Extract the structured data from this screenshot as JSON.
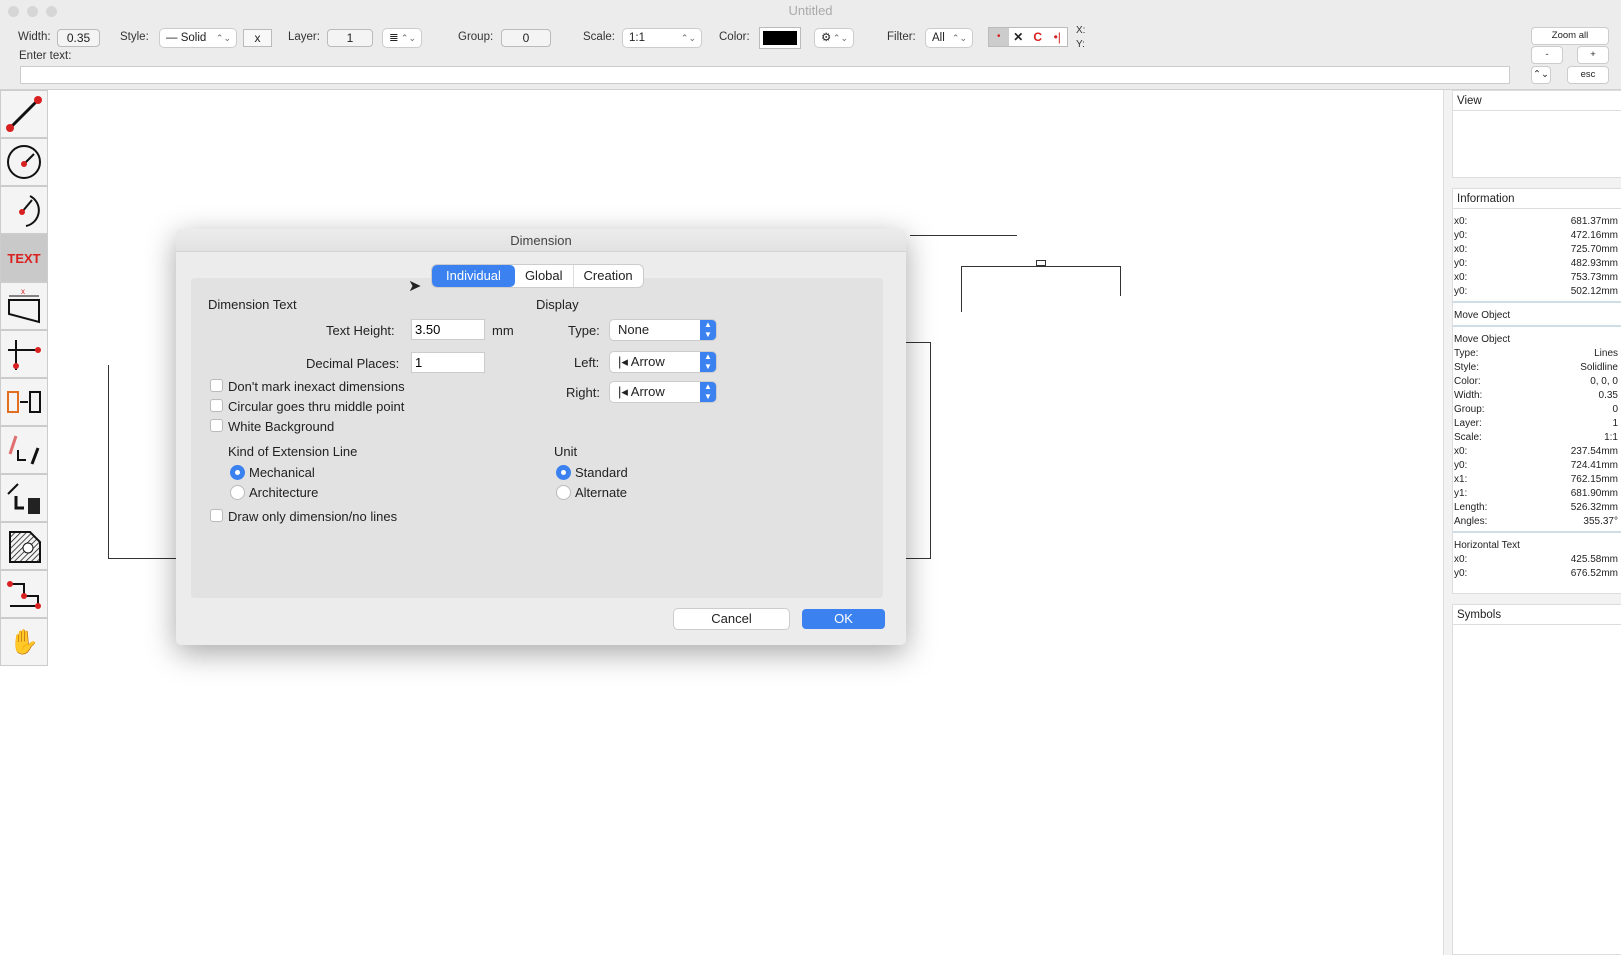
{
  "window": {
    "title": "Untitled"
  },
  "toolbar": {
    "width_label": "Width:",
    "width_value": "0.35",
    "style_label": "Style:",
    "style_value": "Solid",
    "style_clear": "x",
    "layer_label": "Layer:",
    "layer_value": "1",
    "group_label": "Group:",
    "group_value": "0",
    "scale_label": "Scale:",
    "scale_value": "1:1",
    "color_label": "Color:",
    "color_value": "#000000",
    "filter_label": "Filter:",
    "filter_value": "All",
    "x_label": "X:",
    "y_label": "Y:",
    "zoom_all": "Zoom all",
    "zoom_minus": "-",
    "zoom_plus": "+",
    "esc": "esc",
    "enter_text_label": "Enter text:",
    "enter_text_value": ""
  },
  "tools": [
    "line-tool",
    "circle-radius-tool",
    "arc-radius-tool",
    "text-tool",
    "dimension-tool",
    "perpendicular-tool",
    "copy-object-tool",
    "edit-object-tool",
    "delete-object-tool",
    "hatch-tool",
    "polyline-tool",
    "pan-hand-tool"
  ],
  "tools_text": {
    "text": "TEXT"
  },
  "side": {
    "view_title": "View",
    "info_title": "Information",
    "info_rows": [
      [
        "x0:",
        "681.37mm"
      ],
      [
        "y0:",
        "472.16mm"
      ],
      [
        "x0:",
        "725.70mm"
      ],
      [
        "y0:",
        "482.93mm"
      ],
      [
        "x0:",
        "753.73mm"
      ],
      [
        "y0:",
        "502.12mm"
      ]
    ],
    "move1": "Move Object",
    "move2": "Move Object",
    "move_rows": [
      [
        "Type:",
        "Lines"
      ],
      [
        "Style:",
        "Solidline"
      ],
      [
        "Color:",
        "0, 0, 0"
      ],
      [
        "Width:",
        "0.35"
      ],
      [
        "Group:",
        "0"
      ],
      [
        "Layer:",
        "1"
      ],
      [
        "Scale:",
        "1:1"
      ],
      [
        "x0:",
        "237.54mm"
      ],
      [
        "y0:",
        "724.41mm"
      ],
      [
        "x1:",
        "762.15mm"
      ],
      [
        "y1:",
        "681.90mm"
      ],
      [
        "Length:",
        "526.32mm"
      ],
      [
        "Angles:",
        "355.37°"
      ]
    ],
    "htext": "Horizontal Text",
    "htext_rows": [
      [
        "x0:",
        "425.58mm"
      ],
      [
        "y0:",
        "676.52mm"
      ]
    ],
    "symbols_title": "Symbols"
  },
  "dialog": {
    "title": "Dimension",
    "tabs": [
      "Individual",
      "Global",
      "Creation"
    ],
    "active_tab": "Individual",
    "dim_text": "Dimension Text",
    "text_height_label": "Text Height:",
    "text_height": "3.50",
    "mm": "mm",
    "decimal_label": "Decimal Places:",
    "decimal": "1",
    "display": "Display",
    "type_label": "Type:",
    "type_value": "None",
    "left_label": "Left:",
    "left_value": "Arrow",
    "right_label": "Right:",
    "right_value": "Arrow",
    "checks": [
      {
        "label": "Don't mark inexact dimensions",
        "checked": false
      },
      {
        "label": "Circular goes thru middle point",
        "checked": false
      },
      {
        "label": "White Background",
        "checked": false
      }
    ],
    "ext_line": "Kind of Extension Line",
    "ext_options": [
      "Mechanical",
      "Architecture"
    ],
    "ext_selected": "Mechanical",
    "unit": "Unit",
    "unit_options": [
      "Standard",
      "Alternate"
    ],
    "unit_selected": "Standard",
    "draw_only": "Draw only dimension/no lines",
    "draw_only_checked": false,
    "cancel": "Cancel",
    "ok": "OK"
  },
  "colors": {
    "accent": "#3b82f0",
    "tool_red": "#d92020"
  }
}
